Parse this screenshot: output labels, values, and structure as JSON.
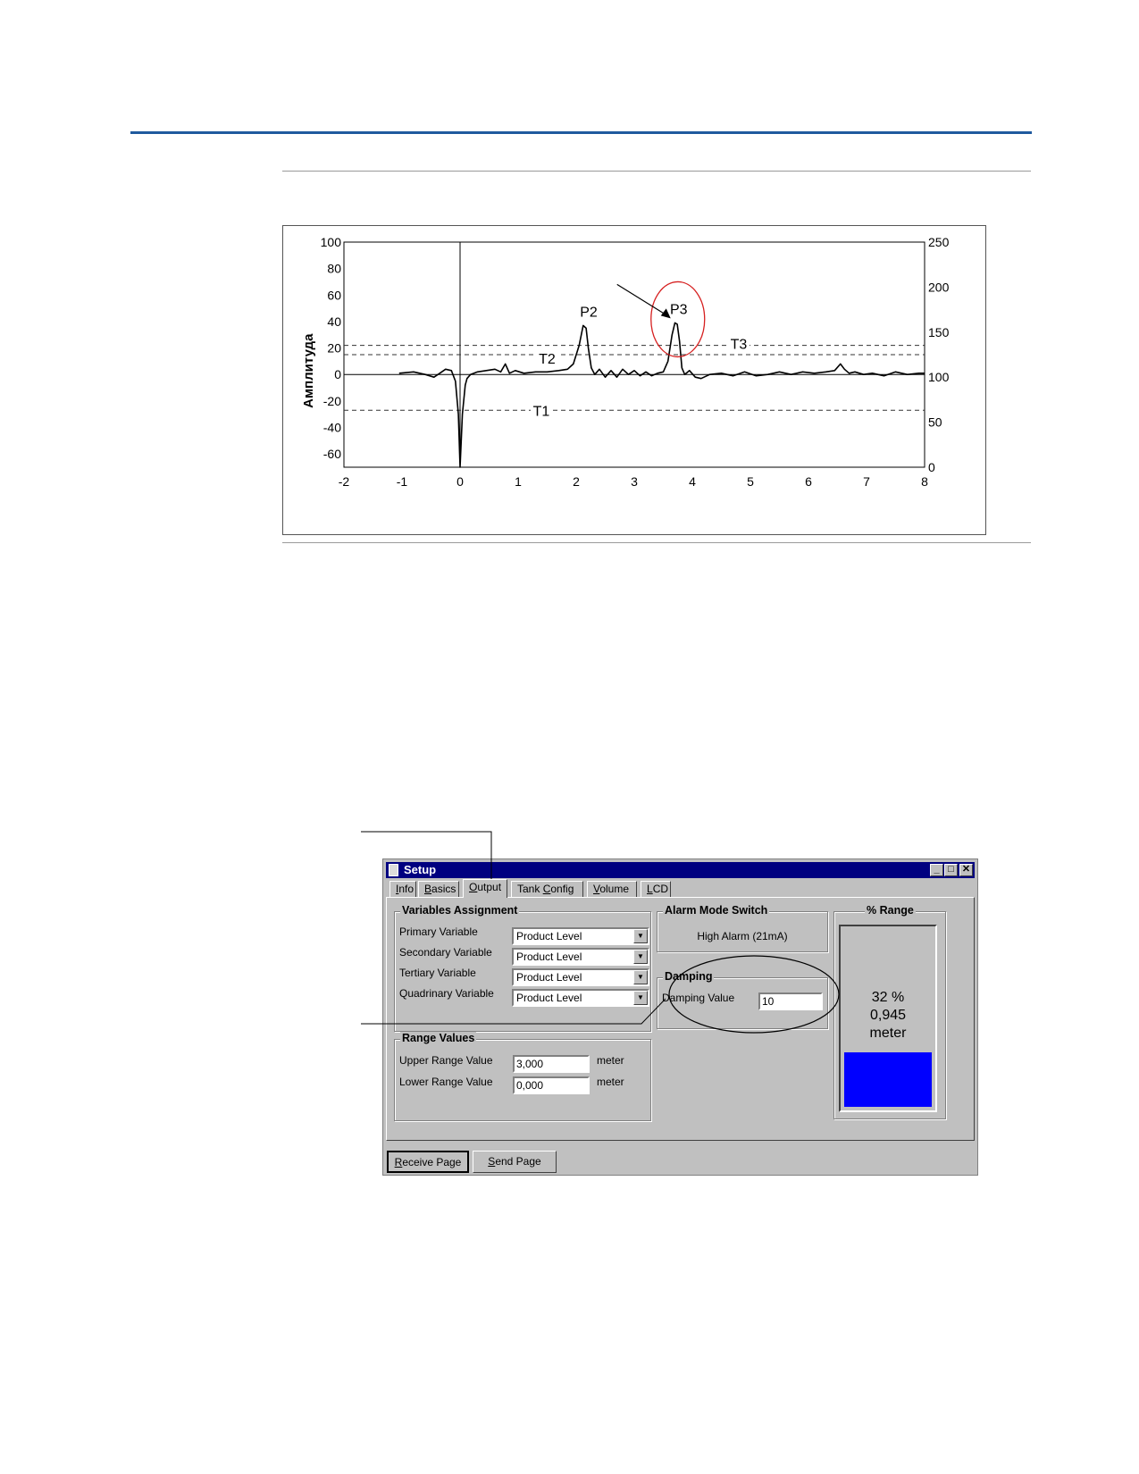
{
  "chart_data": {
    "type": "line",
    "ylabel": "Амплитуда",
    "xlim": [
      -2,
      8
    ],
    "ylim": [
      -70,
      100
    ],
    "ylim_right": [
      0,
      250
    ],
    "x_ticks": [
      -2,
      -1,
      0,
      1,
      2,
      3,
      4,
      5,
      6,
      7,
      8
    ],
    "y_ticks": [
      100,
      80,
      60,
      40,
      20,
      0,
      -20,
      -40,
      -60
    ],
    "y2_ticks": [
      250,
      200,
      150,
      100,
      50,
      0
    ],
    "grid": false,
    "series": [
      {
        "values_x": [
          -1.05,
          -0.8,
          -0.6,
          -0.45,
          -0.35,
          -0.25,
          -0.15,
          -0.08,
          -0.03,
          0.0,
          0.04,
          0.09,
          0.12,
          0.18,
          0.3,
          0.45,
          0.6,
          0.7,
          0.78,
          0.85,
          0.95,
          1.1,
          1.3,
          1.5,
          1.7,
          1.85,
          1.95,
          2.05,
          2.12,
          2.17,
          2.21,
          2.26,
          2.32,
          2.4,
          2.5,
          2.6,
          2.7,
          2.8,
          2.9,
          3.0,
          3.1,
          3.2,
          3.3,
          3.4,
          3.5,
          3.58,
          3.65,
          3.7,
          3.74,
          3.78,
          3.82,
          3.87,
          3.95,
          4.05,
          4.15,
          4.3,
          4.5,
          4.7,
          4.9,
          5.1,
          5.3,
          5.5,
          5.7,
          5.9,
          6.1,
          6.3,
          6.45,
          6.55,
          6.62,
          6.7,
          6.8,
          6.95,
          7.1,
          7.3,
          7.5,
          7.7,
          7.9,
          8.0
        ],
        "values_y": [
          1,
          2,
          0,
          -2,
          1,
          4,
          3,
          -5,
          -30,
          -70,
          -30,
          -8,
          -3,
          0,
          2,
          3,
          4,
          2,
          8,
          1,
          3,
          1,
          2,
          2,
          3,
          4,
          8,
          22,
          37,
          35,
          20,
          5,
          0,
          4,
          -2,
          3,
          -2,
          4,
          0,
          3,
          -1,
          2,
          -1,
          1,
          2,
          10,
          30,
          39,
          38,
          25,
          5,
          0,
          3,
          -2,
          -3,
          0,
          1,
          -1,
          2,
          -1,
          0,
          2,
          0,
          2,
          1,
          2,
          3,
          8,
          4,
          1,
          2,
          0,
          1,
          -1,
          2,
          0,
          1,
          1
        ]
      }
    ],
    "thresholds": [
      {
        "label": "T1",
        "y": -27
      },
      {
        "label": "T2",
        "y": 15
      },
      {
        "label": "T3",
        "y": 22
      }
    ],
    "annotations": [
      {
        "label": "P2",
        "x": 2.2,
        "y": 37
      },
      {
        "label": "P3",
        "x": 3.75,
        "y": 39
      }
    ]
  },
  "window": {
    "title": "Setup",
    "tabs": [
      {
        "pre": "",
        "u": "I",
        "post": "nfo"
      },
      {
        "pre": "",
        "u": "B",
        "post": "asics"
      },
      {
        "pre": "",
        "u": "O",
        "post": "utput"
      },
      {
        "pre": "Tank ",
        "u": "C",
        "post": "onfig"
      },
      {
        "pre": "",
        "u": "V",
        "post": "olume"
      },
      {
        "pre": "",
        "u": "L",
        "post": "CD"
      }
    ],
    "variables": {
      "title": "Variables Assignment",
      "rows": [
        {
          "label": "Primary Variable",
          "value": "Product Level"
        },
        {
          "label": "Secondary Variable",
          "value": "Product Level"
        },
        {
          "label": "Tertiary Variable",
          "value": "Product Level"
        },
        {
          "label": "Quadrinary Variable",
          "value": "Product Level"
        }
      ]
    },
    "alarm": {
      "title": "Alarm Mode Switch",
      "value": "High Alarm (21mA)"
    },
    "damping": {
      "title": "Damping",
      "label": "Damping Value",
      "value": "10"
    },
    "range_values": {
      "title": "Range Values",
      "upper_label": "Upper Range Value",
      "upper_value": "3,000",
      "upper_unit": "meter",
      "lower_label": "Lower Range Value",
      "lower_value": "0,000",
      "lower_unit": "meter"
    },
    "percent_range": {
      "title": "% Range",
      "percent": "32 %",
      "value": "0,945",
      "unit": "meter",
      "fill_fraction": 0.36
    },
    "buttons": {
      "receive": {
        "u": "R",
        "post": "eceive Page"
      },
      "send": {
        "u": "S",
        "post": "end Page"
      }
    }
  },
  "colors": {
    "accent_rule": "#1f5a9e",
    "titlebar": "#000080",
    "range_fill": "#0000ff",
    "highlight_circle": "#d62020"
  }
}
